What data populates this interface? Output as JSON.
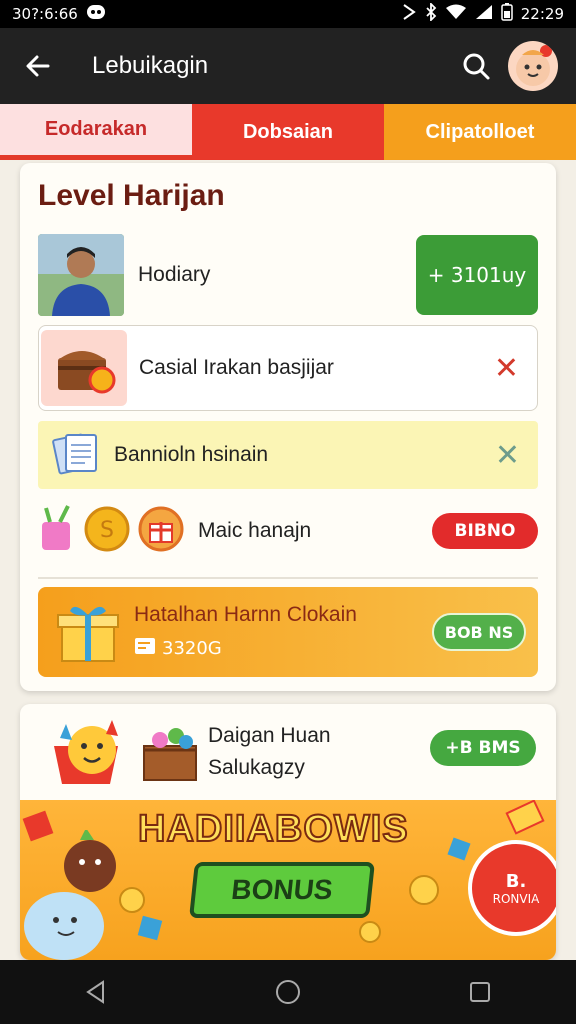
{
  "status_bar": {
    "left_text": "30?:6:66",
    "time": "22:29"
  },
  "header": {
    "title": "Lebuikagin"
  },
  "tabs": [
    {
      "label": "Eodarakan"
    },
    {
      "label": "Dobsaian"
    },
    {
      "label": "Clipatolloet"
    }
  ],
  "level_card": {
    "title": "Level Harijan",
    "rows": [
      {
        "label": "Hodiary",
        "button": "+ 3101uy"
      },
      {
        "label": "Casial Irakan basjijar"
      },
      {
        "label": "Bannioln hsinain"
      },
      {
        "label": "Maic hanajn",
        "button": "BIBNO"
      }
    ],
    "banner": {
      "title": "Hatalhan Harnn Clokain",
      "value": "3320G",
      "button": "BOB ΝS"
    }
  },
  "daily_card": {
    "line1": "Daigan Huan",
    "line2": "Salukagzy",
    "button": "+B BMS"
  },
  "promo": {
    "title": "HADIIABOWIS",
    "button": "BONUS",
    "badge_line1": "B.",
    "badge_line2": "RONVIA"
  },
  "colors": {
    "accent_red": "#e8392b",
    "accent_orange": "#f59f1c",
    "accent_green": "#3c9c37"
  }
}
